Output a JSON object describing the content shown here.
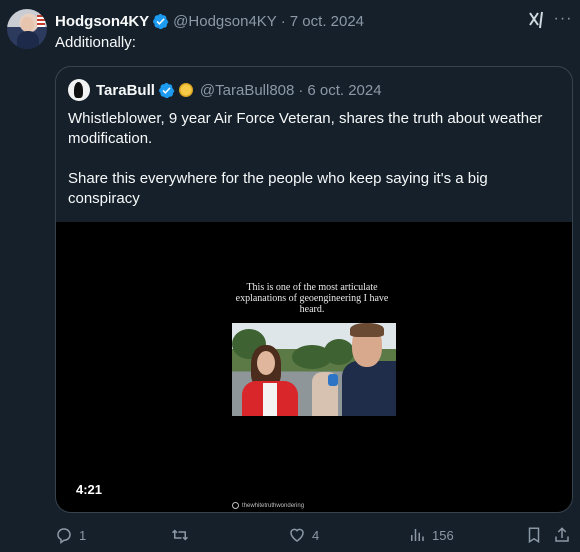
{
  "tweet": {
    "author_name": "Hodgson4KY",
    "handle": "@Hodgson4KY",
    "separator": "·",
    "date": "7 oct. 2024",
    "text": "Additionally:",
    "icons": [
      "verified-badge-icon",
      "grok-icon",
      "more-icon"
    ]
  },
  "quoted": {
    "author_name": "TaraBull",
    "handle": "@TaraBull808",
    "separator": "·",
    "date": "6 oct. 2024",
    "paragraph1": "Whistleblower, 9 year Air Force Veteran, shares the truth about weather modification.",
    "paragraph2": "Share this everywhere for the people who keep saying it's a big conspiracy",
    "video": {
      "caption": "This is one of the most articulate explanations of geoengineering I have heard.",
      "duration": "4:21",
      "watermark": "thewhitetruthwondering"
    }
  },
  "actions": {
    "replies": "1",
    "retweets": "",
    "likes": "4",
    "views": "156"
  },
  "colors": {
    "background": "#15202b",
    "text": "#f7f9f9",
    "muted": "#8b98a5",
    "border": "#38444d",
    "verified": "#1d9bf0"
  }
}
